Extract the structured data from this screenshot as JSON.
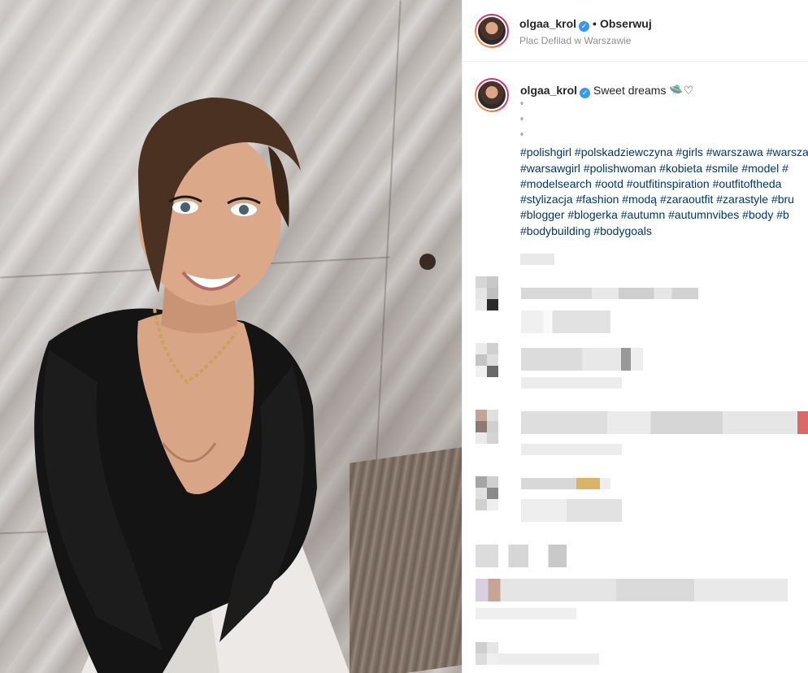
{
  "post": {
    "username": "olgaa_krol",
    "verified_icon": "verified-badge-icon",
    "dot": "•",
    "follow_label": "Obserwuj",
    "location": "Plac Defilad w Warszawie"
  },
  "caption": {
    "username": "olgaa_krol",
    "text": "Sweet dreams",
    "emoji_icons": [
      "ufo-emoji-icon",
      "white-heart-icon"
    ],
    "emoji_glyphs": "🛸♡",
    "dots": [
      "°",
      "°",
      "°"
    ],
    "hashtag_lines": [
      "#polishgirl #polskadziewczyna #girls #warszawa #warszawa",
      "#warsawgirl #polishwoman #kobieta #smile #model #",
      "#modelsearch #ootd #outfitinspiration #outfitoftheda",
      "#stylizacja #fashion #modą #zaraoutfit #zarastyle #bru",
      "#blogger #blogerka #autumn #autumnvibes #body #b",
      "#bodybuilding #bodygoals"
    ]
  },
  "colors": {
    "hashtag": "#00376b",
    "verified": "#3897f0",
    "muted": "#8e8e8e"
  }
}
